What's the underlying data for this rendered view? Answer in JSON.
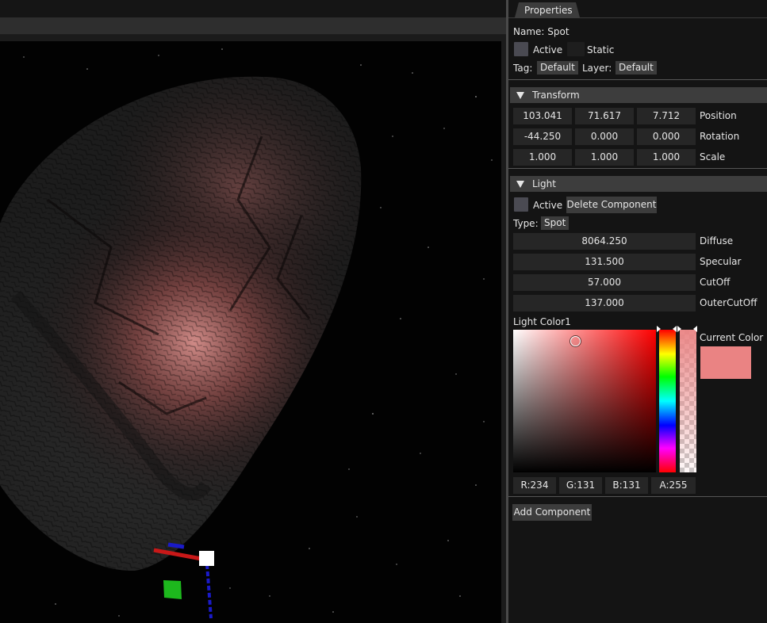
{
  "panel": {
    "tab_title": "Properties",
    "name_text": "Name: Spot",
    "active_label": "Active",
    "static_label": "Static",
    "tag_label": "Tag:",
    "tag_value": "Default",
    "layer_label": "Layer:",
    "layer_value": "Default"
  },
  "transform": {
    "header": "Transform",
    "rows": [
      {
        "label": "Position",
        "values": [
          "103.041",
          "71.617",
          "7.712"
        ]
      },
      {
        "label": "Rotation",
        "values": [
          "-44.250",
          "0.000",
          "0.000"
        ]
      },
      {
        "label": "Scale",
        "values": [
          "1.000",
          "1.000",
          "1.000"
        ]
      }
    ]
  },
  "light": {
    "header": "Light",
    "active_label": "Active",
    "delete_button": "Delete Component",
    "type_label": "Type:",
    "type_value": "Spot",
    "fields": [
      {
        "label": "Diffuse",
        "value": "8064.250"
      },
      {
        "label": "Specular",
        "value": "131.500"
      },
      {
        "label": "CutOff",
        "value": "57.000"
      },
      {
        "label": "OuterCutOff",
        "value": "137.000"
      }
    ],
    "color_label": "Light Color1",
    "current_color_label": "Current Color",
    "current_color": "#ea8383",
    "channels": [
      "R:234",
      "G:131",
      "B:131",
      "A:255"
    ]
  },
  "add_component_button": "Add Component",
  "icons": {
    "header_toggle": "triangle-down-icon",
    "gizmo": "translate-gizmo-icon"
  }
}
